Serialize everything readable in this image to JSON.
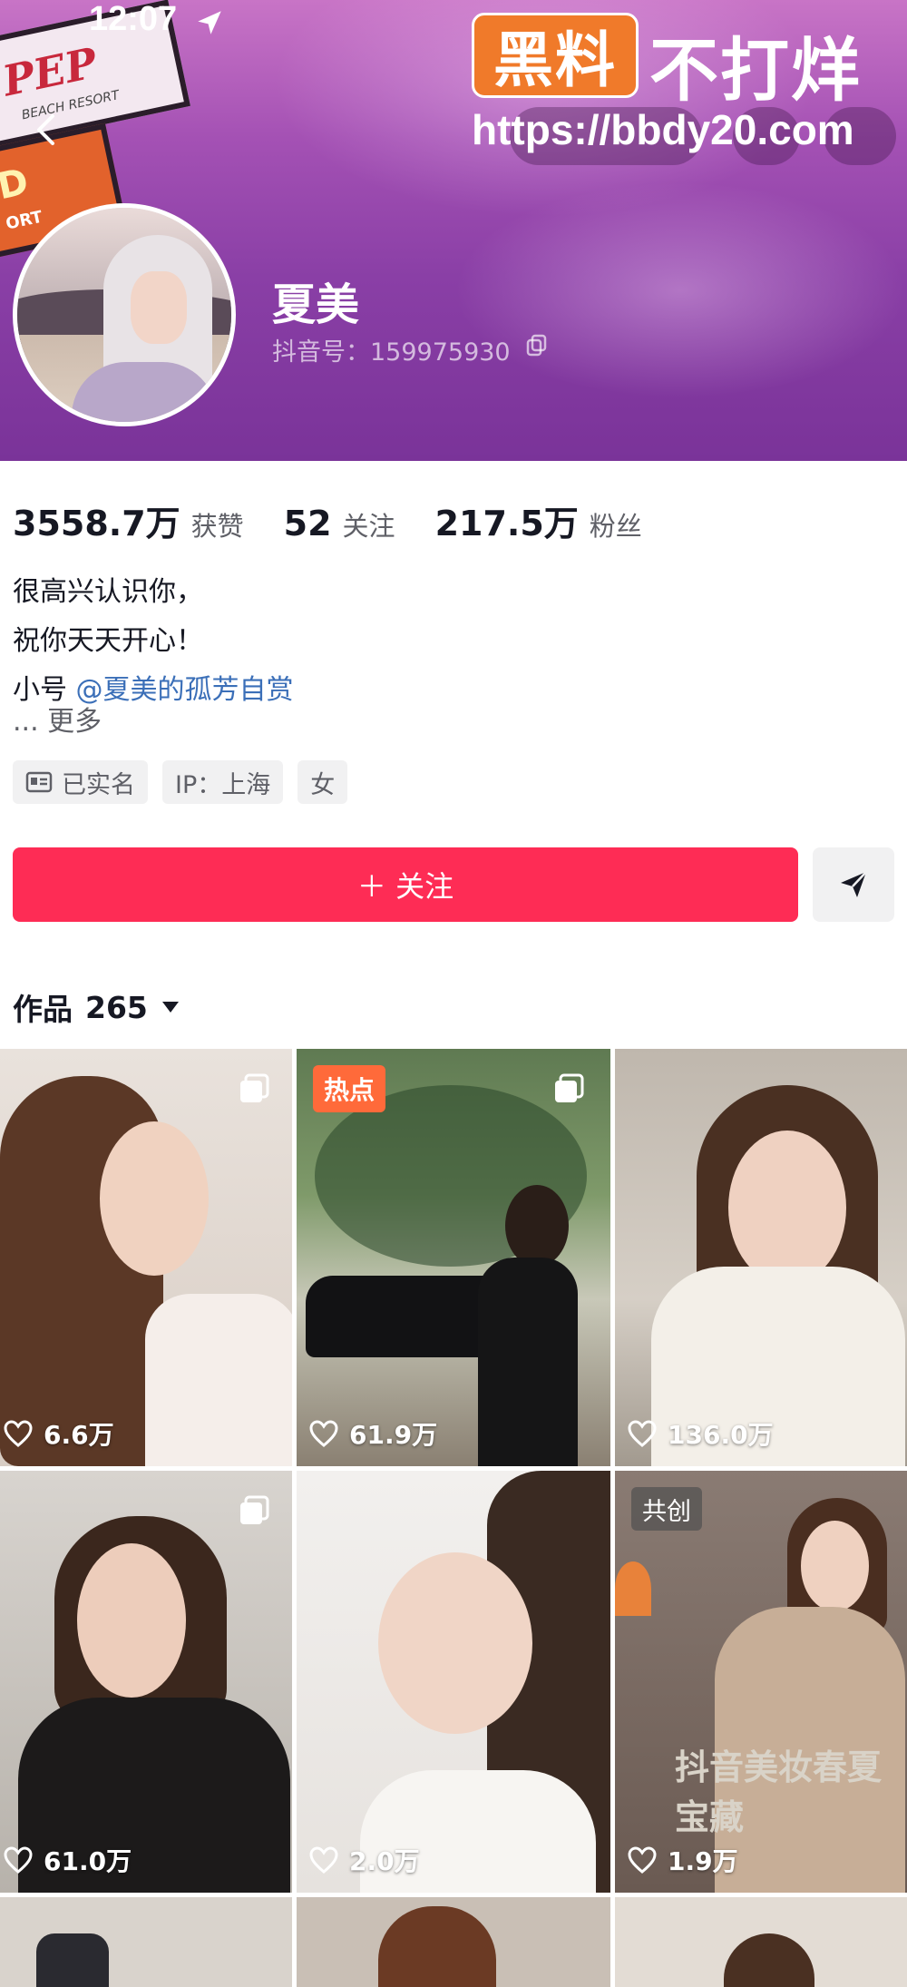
{
  "status_bar": {
    "time": "12:07"
  },
  "header": {
    "username": "夏美",
    "douyin_id": "抖音号：159975930",
    "bg_sign_text": "PEP",
    "bg_sign_sub": "BEACH RESORT",
    "bg_sign2_text": "D",
    "bg_sign2_sub": "ORT"
  },
  "watermark": {
    "box_text": "黑料",
    "side_text": "不打烊",
    "url": "https://bbdy20.com"
  },
  "stats": [
    {
      "value": "3558.7万",
      "label": "获赞"
    },
    {
      "value": "52",
      "label": "关注"
    },
    {
      "value": "217.5万",
      "label": "粉丝"
    }
  ],
  "bio": {
    "line1": "很高兴认识你，",
    "line2": "祝你天天开心！",
    "line3_prefix": "小号 ",
    "line3_link": "@夏美的孤芳自赏",
    "more": "...  更多"
  },
  "tags": [
    {
      "icon": "id-card-icon",
      "label": "已实名"
    },
    {
      "label": "IP：上海"
    },
    {
      "label": "女"
    }
  ],
  "actions": {
    "follow_label": "＋ 关注",
    "share_icon": "send-icon"
  },
  "works": {
    "label": "作品",
    "count": "265"
  },
  "grid": [
    {
      "likes": "6.6万",
      "multi": true
    },
    {
      "likes": "61.9万",
      "badge": "热点",
      "multi": true
    },
    {
      "likes": "136.0万"
    },
    {
      "likes": "61.0万",
      "multi": true
    },
    {
      "likes": "2.0万"
    },
    {
      "likes": "1.9万",
      "badge": "共创",
      "caption": "抖音美妆春夏宝藏"
    }
  ],
  "colors": {
    "accent": "#fe2c55",
    "link": "#3b6fb8",
    "hot": "#ff6a3a",
    "watermark": "#f07a2a"
  }
}
